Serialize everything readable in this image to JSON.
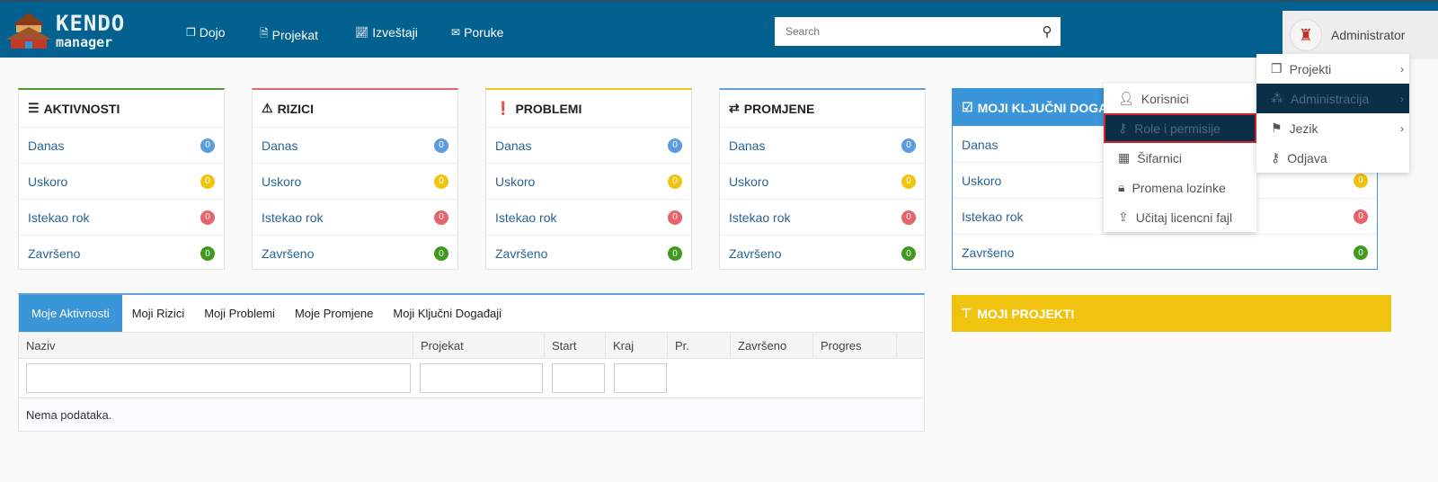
{
  "header": {
    "logo_text_top": "KENDO",
    "logo_text_bottom": "manager",
    "nav": [
      {
        "label": "Dojo",
        "icon": "copy-icon"
      },
      {
        "label": "Projekat",
        "icon": "file-icon"
      },
      {
        "label": "Izveštaji",
        "icon": "chart-line-icon"
      },
      {
        "label": "Poruke",
        "icon": "envelope-icon"
      }
    ],
    "search_placeholder": "Search",
    "user": "Administrator"
  },
  "cards": [
    {
      "title": "AKTIVNOSTI",
      "icon": "tasks-icon",
      "color": "#4e9a2f"
    },
    {
      "title": "RIZICI",
      "icon": "warning-icon",
      "color": "#e06a70"
    },
    {
      "title": "PROBLEMI",
      "icon": "exclamation-circle-icon",
      "color": "#e8c81a"
    },
    {
      "title": "PROMJENE",
      "icon": "exchange-icon",
      "color": "#6a9fd4"
    },
    {
      "title": "MOJI KLJUČNI DOGAĐAJI",
      "icon": "check-square-icon",
      "color": "#3b95d9"
    }
  ],
  "card_rows": [
    {
      "label": "Danas",
      "count": "0",
      "color": "#5b9be0"
    },
    {
      "label": "Uskoro",
      "count": "0",
      "color": "#f0c30f"
    },
    {
      "label": "Istekao rok",
      "count": "0",
      "color": "#e8636b"
    },
    {
      "label": "Završeno",
      "count": "0",
      "color": "#3f9a1f"
    }
  ],
  "tabs": [
    "Moje Aktivnosti",
    "Moji Rizici",
    "Moji Problemi",
    "Moje Promjene",
    "Moji Ključni Događaji"
  ],
  "columns": [
    "Naziv",
    "Projekat",
    "Start",
    "Kraj",
    "Pr.",
    "Završeno",
    "Progres"
  ],
  "empty_text": "Nema podataka.",
  "projects_title": "MOJI PROJEKTI",
  "user_menu": [
    {
      "label": "Projekti",
      "icon": "copy-icon"
    },
    {
      "label": "Administracija",
      "icon": "cubes-icon"
    },
    {
      "label": "Jezik",
      "icon": "flag-icon"
    },
    {
      "label": "Odjava",
      "icon": "key-icon"
    }
  ],
  "admin_submenu": [
    {
      "label": "Korisnici",
      "icon": "user-icon"
    },
    {
      "label": "Role i permisije",
      "icon": "key-icon"
    },
    {
      "label": "Šifarnici",
      "icon": "table-icon"
    },
    {
      "label": "Promena lozinke",
      "icon": "lock-icon"
    },
    {
      "label": "Učitaj licencni fajl",
      "icon": "upload-icon"
    }
  ]
}
